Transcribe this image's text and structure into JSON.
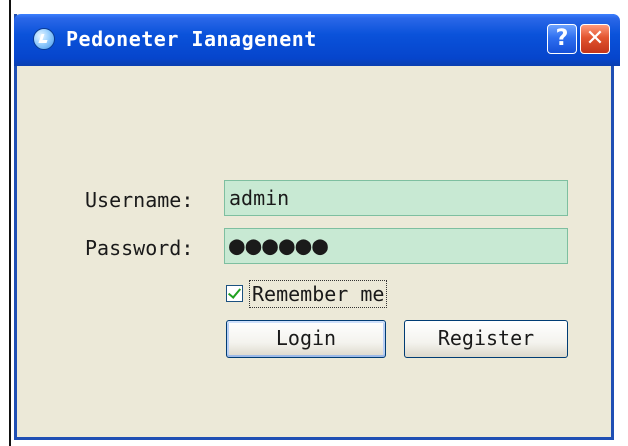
{
  "window": {
    "title": "Pedoneter Ianagenent",
    "help_label": "?",
    "close_label": "✕"
  },
  "form": {
    "username_label": "Username:",
    "username_value": "admin",
    "password_label": "Password:",
    "password_value": "●●●●●●",
    "remember_label": "Remember me",
    "remember_checked": true
  },
  "buttons": {
    "login_label": "Login",
    "register_label": "Register"
  },
  "colors": {
    "titlebar": "#0a52da",
    "window_bg": "#ece9d8",
    "field_bg": "#c8e9d3",
    "close_button": "#e2552f"
  },
  "icons": {
    "app_icon": "app-logo-icon",
    "help": "help-icon",
    "close": "close-icon",
    "checkbox": "checkmark-icon"
  }
}
